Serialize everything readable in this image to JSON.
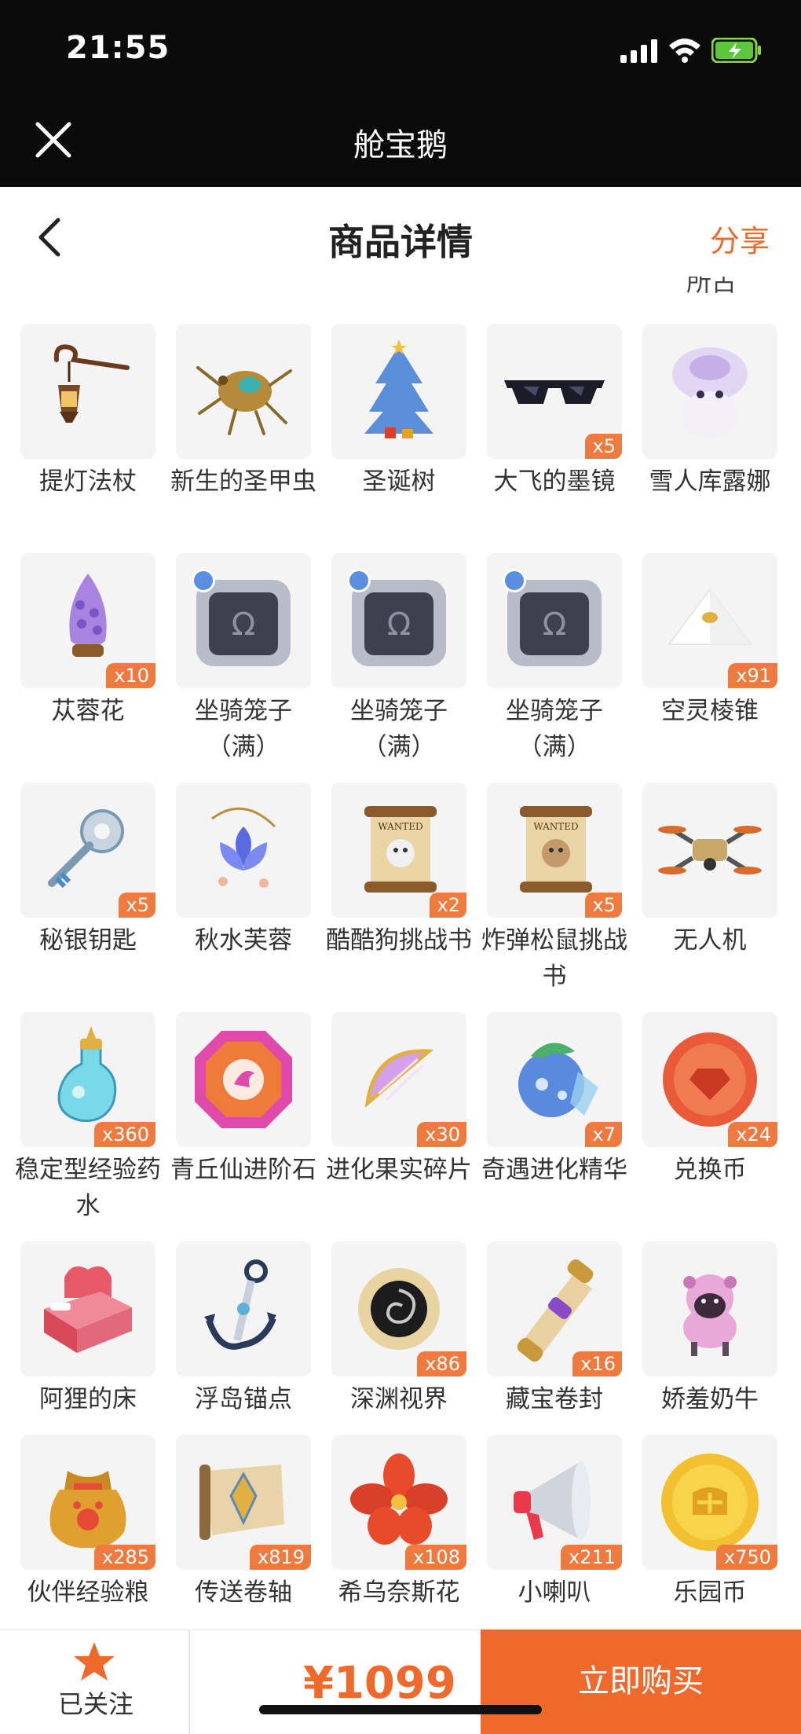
{
  "status_bar": {
    "time": "21:55"
  },
  "app": {
    "title": "舱宝鹅"
  },
  "header": {
    "title": "商品详情",
    "share_label": "分享",
    "clipped_text": "所占"
  },
  "items": [
    {
      "name": "提灯法杖",
      "count": "",
      "icon": "lantern-staff-icon"
    },
    {
      "name": "新生的圣甲虫",
      "count": "",
      "icon": "scarab-icon"
    },
    {
      "name": "圣诞树",
      "count": "",
      "icon": "christmas-tree-icon"
    },
    {
      "name": "大飞的墨镜",
      "count": "x5",
      "icon": "sunglasses-icon"
    },
    {
      "name": "雪人库露娜",
      "count": "",
      "icon": "snowman-icon"
    },
    {
      "name": "苁蓉花",
      "count": "x10",
      "icon": "cistanche-flower-icon"
    },
    {
      "name": "坐骑笼子（满）",
      "count": "",
      "icon": "mount-cage-icon"
    },
    {
      "name": "坐骑笼子（满）",
      "count": "",
      "icon": "mount-cage-icon"
    },
    {
      "name": "坐骑笼子（满）",
      "count": "",
      "icon": "mount-cage-icon"
    },
    {
      "name": "空灵棱锥",
      "count": "x91",
      "icon": "pyramid-icon"
    },
    {
      "name": "秘银钥匙",
      "count": "x5",
      "icon": "key-icon"
    },
    {
      "name": "秋水芙蓉",
      "count": "",
      "icon": "lotus-icon"
    },
    {
      "name": "酷酷狗挑战书",
      "count": "x2",
      "icon": "wanted-scroll-icon"
    },
    {
      "name": "炸弹松鼠挑战书",
      "count": "x5",
      "icon": "wanted-scroll-icon"
    },
    {
      "name": "无人机",
      "count": "",
      "icon": "drone-icon"
    },
    {
      "name": "稳定型经验药水",
      "count": "x360",
      "icon": "potion-icon"
    },
    {
      "name": "青丘仙进阶石",
      "count": "",
      "icon": "gem-icon"
    },
    {
      "name": "进化果实碎片",
      "count": "x30",
      "icon": "fruit-slice-icon"
    },
    {
      "name": "奇遇进化精华",
      "count": "x7",
      "icon": "berry-essence-icon"
    },
    {
      "name": "兑换币",
      "count": "x24",
      "icon": "red-coin-icon"
    },
    {
      "name": "阿狸的床",
      "count": "",
      "icon": "bed-icon"
    },
    {
      "name": "浮岛锚点",
      "count": "",
      "icon": "anchor-icon"
    },
    {
      "name": "深渊视界",
      "count": "x86",
      "icon": "abyss-eye-icon"
    },
    {
      "name": "藏宝卷封",
      "count": "x16",
      "icon": "treasure-scroll-icon"
    },
    {
      "name": "娇羞奶牛",
      "count": "",
      "icon": "cow-icon"
    },
    {
      "name": "伙伴经验粮",
      "count": "x285",
      "icon": "food-bag-icon"
    },
    {
      "name": "传送卷轴",
      "count": "x819",
      "icon": "teleport-scroll-icon"
    },
    {
      "name": "希乌奈斯花",
      "count": "x108",
      "icon": "red-flower-icon"
    },
    {
      "name": "小喇叭",
      "count": "x211",
      "icon": "megaphone-icon"
    },
    {
      "name": "乐园币",
      "count": "x750",
      "icon": "gold-coin-icon"
    }
  ],
  "bottom": {
    "follow_label": "已关注",
    "price": "¥1099",
    "buy_label": "立即购买"
  },
  "colors": {
    "accent": "#ee6a2c",
    "badge": "#ee7a40",
    "tile_bg": "#f4f4f4"
  }
}
